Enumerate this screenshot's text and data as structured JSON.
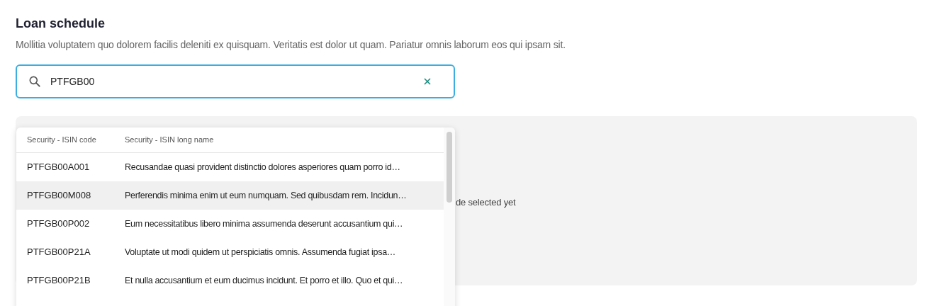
{
  "title": "Loan schedule",
  "description": "Mollitia voluptatem quo dolorem facilis deleniti ex quisquam. Veritatis est dolor ut quam. Pariatur omnis laborum eos qui ipsam sit.",
  "search": {
    "value": "PTFGB00"
  },
  "panel": {
    "message": "de selected yet"
  },
  "dropdown": {
    "columns": [
      "Security - ISIN code",
      "Security - ISIN long name"
    ],
    "rows": [
      {
        "code": "PTFGB00A001",
        "name": "Recusandae quasi provident distinctio dolores asperiores quam porro id…",
        "highlighted": false
      },
      {
        "code": "PTFGB00M008",
        "name": "Perferendis minima enim ut eum numquam. Sed quibusdam rem. Incidun…",
        "highlighted": true
      },
      {
        "code": "PTFGB00P002",
        "name": "Eum necessitatibus libero minima assumenda deserunt accusantium qui…",
        "highlighted": false
      },
      {
        "code": "PTFGB00P21A",
        "name": "Voluptate ut modi quidem ut perspiciatis omnis. Assumenda fugiat ipsa…",
        "highlighted": false
      },
      {
        "code": "PTFGB00P21B",
        "name": "Et nulla accusantium et eum ducimus incidunt. Et porro et illo. Quo et qui…",
        "highlighted": false
      }
    ]
  }
}
